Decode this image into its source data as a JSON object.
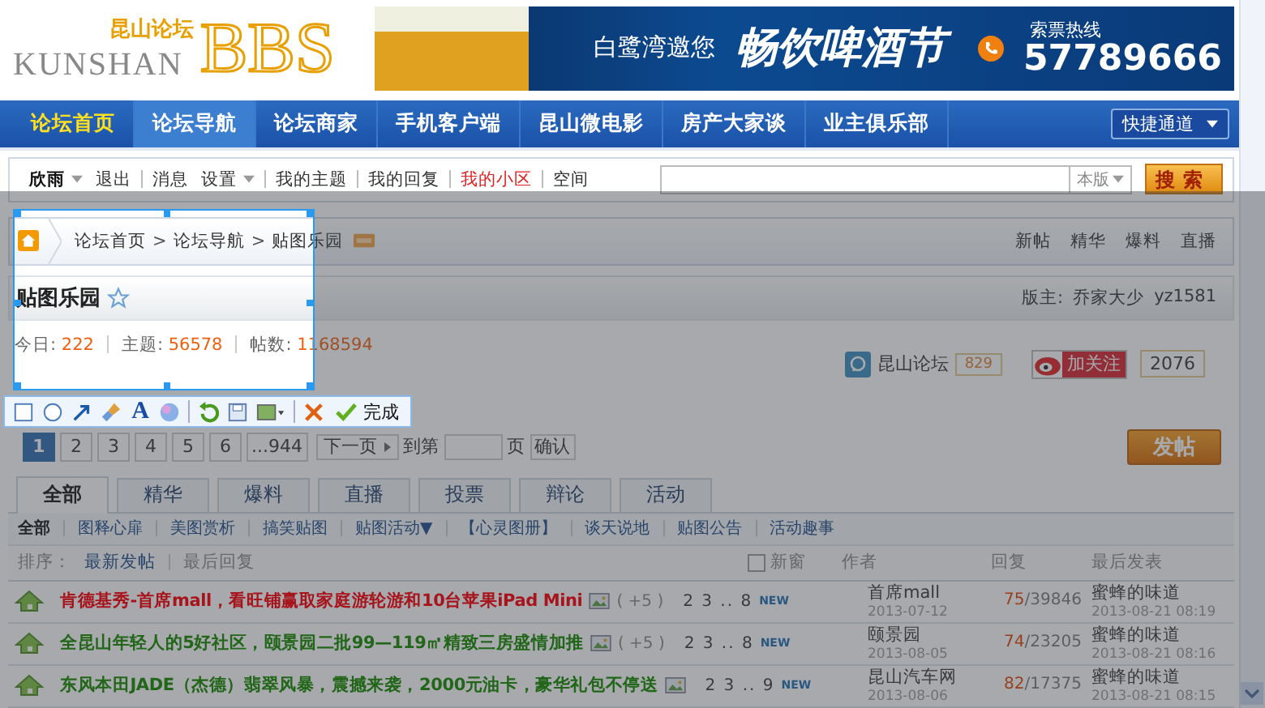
{
  "header": {
    "logo": {
      "chinese": "昆山论坛",
      "latin": "KUNSHAN",
      "bbs": "BBS"
    },
    "banner": {
      "invite": "白鹭湾邀您",
      "title": "畅饮啤酒节",
      "hotline_label": "索票热线",
      "phone": "57789666"
    }
  },
  "nav": {
    "items": [
      {
        "label": "论坛首页",
        "selected": false,
        "highlighted": true
      },
      {
        "label": "论坛导航",
        "selected": true,
        "highlighted": false
      },
      {
        "label": "论坛商家",
        "selected": false,
        "highlighted": false
      },
      {
        "label": "手机客户端",
        "selected": false,
        "highlighted": false
      },
      {
        "label": "昆山微电影",
        "selected": false,
        "highlighted": false
      },
      {
        "label": "房产大家谈",
        "selected": false,
        "highlighted": false
      },
      {
        "label": "业主俱乐部",
        "selected": false,
        "highlighted": false
      }
    ],
    "quick_menu": "快捷通道"
  },
  "user_bar": {
    "groups": [
      [
        {
          "label": "欣雨",
          "kind": "user"
        },
        {
          "label": "退出",
          "kind": "link"
        }
      ],
      [
        {
          "label": "消息",
          "kind": "link"
        },
        {
          "label": "设置",
          "kind": "menu"
        }
      ],
      [
        {
          "label": "我的主题",
          "kind": "link"
        }
      ],
      [
        {
          "label": "我的回复",
          "kind": "link"
        }
      ],
      [
        {
          "label": "我的小区",
          "kind": "highlight"
        }
      ],
      [
        {
          "label": "空间",
          "kind": "link"
        }
      ]
    ],
    "search": {
      "scope": "本版",
      "button": "搜索"
    }
  },
  "breadcrumb": {
    "items": [
      "论坛首页",
      "论坛导航",
      "贴图乐园"
    ],
    "separator": ">",
    "links": [
      "新帖",
      "精华",
      "爆料",
      "直播"
    ]
  },
  "forum": {
    "title": "贴图乐园",
    "moderators_label": "版主:",
    "moderators": [
      "乔家大少",
      "yz1581"
    ],
    "stats": [
      {
        "label": "今日:",
        "value": "222"
      },
      {
        "label": "主题:",
        "value": "56578"
      },
      {
        "label": "帖数:",
        "value": "1168594"
      }
    ],
    "social": {
      "name": "昆山论坛",
      "name_count": "829",
      "follow": "加关注",
      "follow_count": "2076"
    }
  },
  "pagination": {
    "pages": [
      {
        "label": "1",
        "selected": true
      },
      {
        "label": "2",
        "selected": false
      },
      {
        "label": "3",
        "selected": false
      },
      {
        "label": "4",
        "selected": false
      },
      {
        "label": "5",
        "selected": false
      },
      {
        "label": "6",
        "selected": false
      },
      {
        "label": "...944",
        "selected": false
      }
    ],
    "next": "下一页",
    "goto_prefix": "到第",
    "goto_suffix": "页",
    "confirm": "确认"
  },
  "post_button": "发帖",
  "tabs": [
    {
      "label": "全部",
      "selected": true
    },
    {
      "label": "精华",
      "selected": false
    },
    {
      "label": "爆料",
      "selected": false
    },
    {
      "label": "直播",
      "selected": false
    },
    {
      "label": "投票",
      "selected": false
    },
    {
      "label": "辩论",
      "selected": false
    },
    {
      "label": "活动",
      "selected": false
    }
  ],
  "filters": [
    {
      "label": "全部",
      "selected": true
    },
    {
      "label": "图释心扉",
      "selected": false
    },
    {
      "label": "美图赏析",
      "selected": false
    },
    {
      "label": "搞笑贴图",
      "selected": false
    },
    {
      "label": "贴图活动▼",
      "selected": false
    },
    {
      "label": "【心灵图册】",
      "selected": false
    },
    {
      "label": "谈天说地",
      "selected": false
    },
    {
      "label": "贴图公告",
      "selected": false
    },
    {
      "label": "活动趣事",
      "selected": false
    }
  ],
  "sort": {
    "label": "排序：",
    "options": [
      {
        "label": "最新发帖",
        "selected": true
      },
      {
        "label": "最后回复",
        "selected": false
      }
    ]
  },
  "columns": {
    "new_window": {
      "label": "新窗",
      "checked": false
    },
    "author": "作者",
    "replies": "回复",
    "last_post": "最后发表",
    "count_separator": "/"
  },
  "threads": [
    {
      "title": "肯德基秀-首席mall，看旺铺赢取家庭游轮游和10台苹果iPad Mini",
      "color": "#a8141c",
      "has_image": true,
      "extra": "( +5 )",
      "pages": "2 3 .. 8",
      "badge": "NEW",
      "author": "首席mall",
      "author_date": "2013-07-12",
      "replies": "75",
      "views": "39846",
      "last_author": "蜜蜂的味道",
      "last_date": "2013-08-21 08:19"
    },
    {
      "title": "全昆山年轻人的5好社区，颐景园二批99—119㎡精致三房盛情加推",
      "color": "#22661a",
      "has_image": true,
      "extra": "( +5 )",
      "pages": "2 3 .. 8",
      "badge": "NEW",
      "author": "颐景园",
      "author_date": "2013-08-05",
      "replies": "74",
      "views": "23205",
      "last_author": "蜜蜂的味道",
      "last_date": "2013-08-21 08:16"
    },
    {
      "title": "东风本田JADE（杰德）翡翠风暴，震撼来袭，2000元油卡，豪华礼包不停送",
      "color": "#22661a",
      "has_image": true,
      "pages": "2 3 .. 9",
      "badge": "NEW",
      "author": "昆山汽车网",
      "author_date": "2013-08-06",
      "replies": "82",
      "views": "17375",
      "last_author": "蜜蜂的味道",
      "last_date": "2013-08-21 08:15"
    }
  ],
  "capture_tool": {
    "text_tool": "A",
    "done": "完成"
  }
}
